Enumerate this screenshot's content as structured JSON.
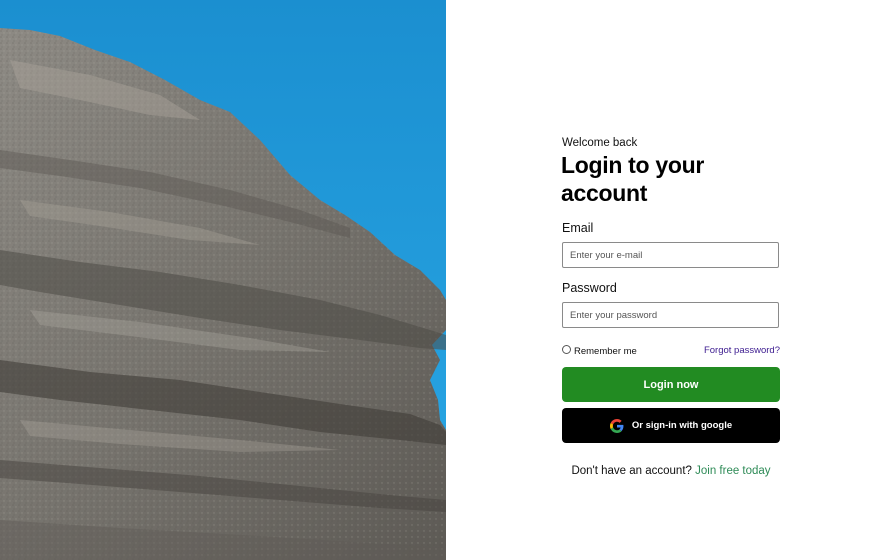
{
  "hero": {
    "image": "rocky-cliff-under-blue-sky"
  },
  "login": {
    "welcome": "Welcome back",
    "title": "Login to your account",
    "email_label": "Email",
    "email_placeholder": "Enter your e-mail",
    "password_label": "Password",
    "password_placeholder": "Enter your password",
    "remember_label": "Remember me",
    "forgot_label": "Forgot password?",
    "login_button": "Login now",
    "google_button": "Or sign-in with google"
  },
  "signup": {
    "prompt": "Don't have an account?",
    "link": "Join free today"
  },
  "colors": {
    "primary_button": "#228b22",
    "google_button": "#000000",
    "link": "#2e8b57",
    "forgot_link": "#3c1b8f"
  },
  "icons": {
    "google": "google-icon"
  }
}
